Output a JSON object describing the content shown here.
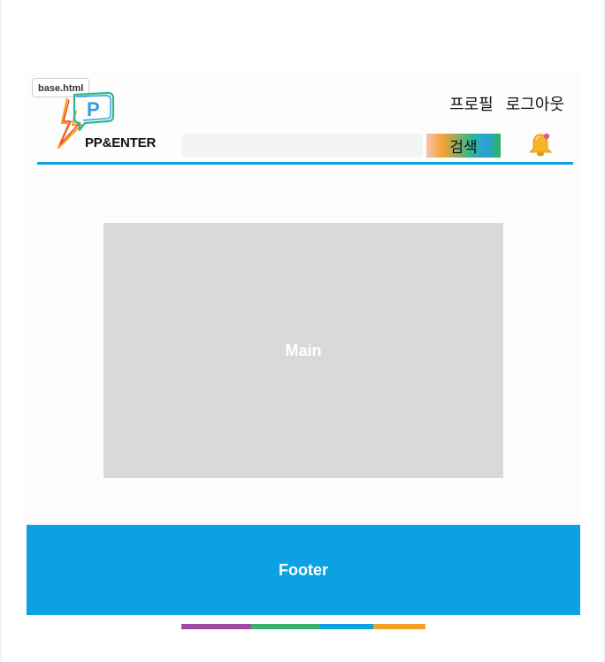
{
  "file_tag": "base.html",
  "header": {
    "brand": "PP&ENTER",
    "logo_letter": "P",
    "nav": {
      "profile": "프로필",
      "logout": "로그아웃"
    },
    "search": {
      "placeholder": "",
      "button_label": "검색"
    }
  },
  "main": {
    "label": "Main"
  },
  "footer": {
    "label": "Footer"
  },
  "colors": {
    "accent": "#0ba1e2",
    "placeholder_gray": "#d9d9d9",
    "stripe": [
      "#9b4ea0",
      "#3bb06a",
      "#0ba1e2",
      "#f4a21f"
    ]
  },
  "icons": {
    "notification": "bell-icon",
    "logo": "speech-bubble-logo-icon"
  }
}
